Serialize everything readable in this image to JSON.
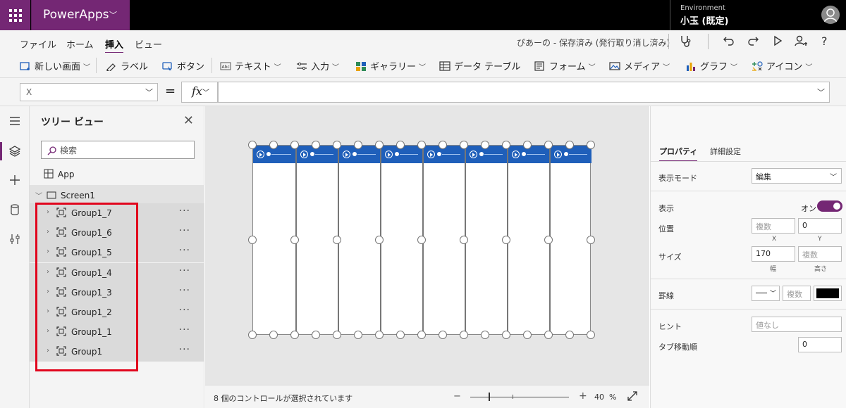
{
  "app": {
    "title": "PowerApps",
    "env_label": "Environment",
    "env_name": "小玉 (既定)"
  },
  "menu": {
    "items": [
      "ファイル",
      "ホーム",
      "挿入",
      "ビュー"
    ],
    "active": "挿入",
    "save_status": "ぴあーの - 保存済み (発行取り消し済み)"
  },
  "ribbon": {
    "new_screen": "新しい画面",
    "label": "ラベル",
    "button": "ボタン",
    "text": "テキスト",
    "input": "入力",
    "gallery": "ギャラリー",
    "data_table": "データ テーブル",
    "form": "フォーム",
    "media": "メディア",
    "chart": "グラフ",
    "icon": "アイコン"
  },
  "formula": {
    "property": "X",
    "equals": "=",
    "fx": "fx",
    "value": ""
  },
  "tree": {
    "title": "ツリー ビュー",
    "search_placeholder": "検索",
    "app_node": "App",
    "screen_node": "Screen1",
    "controls": [
      "Group1_7",
      "Group1_6",
      "Group1_5",
      "Group1_4",
      "Group1_3",
      "Group1_2",
      "Group1_1",
      "Group1"
    ],
    "more": "···"
  },
  "status": {
    "text": "8 個のコントロールが選択されています",
    "zoom": "40",
    "zoom_unit": "%",
    "zoom_minus": "−",
    "zoom_plus": "+"
  },
  "props": {
    "tab_properties": "プロパティ",
    "tab_advanced": "詳細設定",
    "display_mode_label": "表示モード",
    "display_mode_value": "編集",
    "visible_label": "表示",
    "visible_value": "オン",
    "position_label": "位置",
    "pos_x": "複数",
    "pos_y": "0",
    "x_label": "X",
    "y_label": "Y",
    "size_label": "サイズ",
    "width": "170",
    "height": "複数",
    "width_label": "幅",
    "height_label": "高さ",
    "border_label": "罫線",
    "border_width": "複数",
    "hint_label": "ヒント",
    "hint_placeholder": "値なし",
    "tab_order_label": "タブ移動順",
    "tab_order": "0"
  },
  "colors": {
    "brand": "#742774",
    "gallery_header": "#1f5fba",
    "selection_box": "#e1061d",
    "toggle_on": "#742774"
  }
}
